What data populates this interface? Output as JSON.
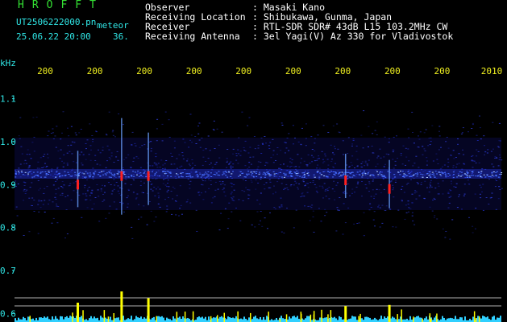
{
  "header": {
    "title": "HROFFT",
    "filename": "UT2506222000.pn",
    "filename_suffix": "meteor",
    "datetime": "25.06.22 20:00",
    "count": "36."
  },
  "info": [
    {
      "label": "Observer",
      "value": ": Masaki Kano"
    },
    {
      "label": "Receiving Location",
      "value": ": Shibukawa, Gunma, Japan"
    },
    {
      "label": "Receiver",
      "value": ": RTL-SDR SDR# 43dB L15 103.2MHz CW"
    },
    {
      "label": "Receiving Antenna",
      "value": ": 3el Yagi(V) Az 330 for Vladivostok"
    }
  ],
  "colors": {
    "text_green": "#33e033",
    "text_cyan": "#30e8e8",
    "text_white": "#ffffff",
    "tick_yellow": "#f0f020",
    "band_blue": "#2a3cff",
    "spike_red": "#ff2020",
    "meteor_yellow": "#ffff00"
  },
  "chart_data": {
    "type": "heatmap",
    "ylabel": "kHz",
    "y_ticks": [
      "1.1",
      "1.0",
      "0.9",
      "0.8",
      "0.7",
      "0.6"
    ],
    "ylim": [
      0.58,
      1.18
    ],
    "x_ticks": [
      "200",
      "200",
      "200",
      "200",
      "200",
      "200",
      "200",
      "200",
      "200",
      "2010"
    ],
    "band_center_khz": 0.925,
    "meteor_spikes": [
      {
        "x": 0.22,
        "y": 0.92,
        "strength": 1.0
      },
      {
        "x": 0.13,
        "y": 0.9,
        "strength": 0.5
      },
      {
        "x": 0.275,
        "y": 0.92,
        "strength": 0.7
      },
      {
        "x": 0.77,
        "y": 0.89,
        "strength": 0.4
      },
      {
        "x": 0.68,
        "y": 0.91,
        "strength": 0.35
      }
    ]
  }
}
